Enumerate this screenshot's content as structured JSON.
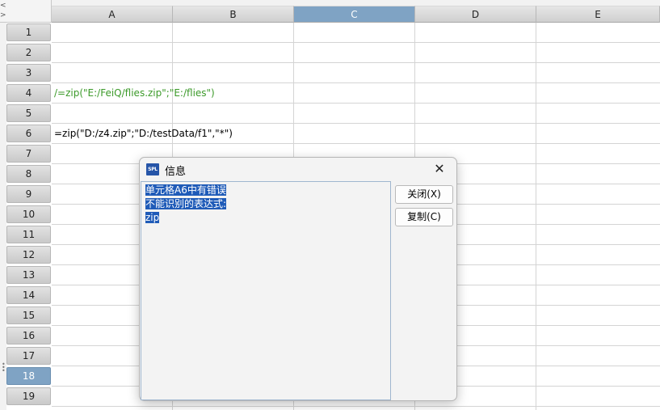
{
  "columns": [
    {
      "label": "A",
      "selected": false
    },
    {
      "label": "B",
      "selected": false
    },
    {
      "label": "C",
      "selected": true
    },
    {
      "label": "D",
      "selected": false
    },
    {
      "label": "E",
      "selected": false
    }
  ],
  "rows": [
    {
      "label": "1",
      "selected": false
    },
    {
      "label": "2",
      "selected": false
    },
    {
      "label": "3",
      "selected": false
    },
    {
      "label": "4",
      "selected": false
    },
    {
      "label": "5",
      "selected": false
    },
    {
      "label": "6",
      "selected": false
    },
    {
      "label": "7",
      "selected": false
    },
    {
      "label": "8",
      "selected": false
    },
    {
      "label": "9",
      "selected": false
    },
    {
      "label": "10",
      "selected": false
    },
    {
      "label": "11",
      "selected": false
    },
    {
      "label": "12",
      "selected": false
    },
    {
      "label": "13",
      "selected": false
    },
    {
      "label": "14",
      "selected": false
    },
    {
      "label": "15",
      "selected": false
    },
    {
      "label": "16",
      "selected": false
    },
    {
      "label": "17",
      "selected": false
    },
    {
      "label": "18",
      "selected": true
    },
    {
      "label": "19",
      "selected": false
    }
  ],
  "cells": {
    "A4": {
      "text": "/=zip(\"E:/FeiQ/flies.zip\";\"E:/flies\")",
      "color": "#3c9a2a"
    },
    "A6": {
      "text": "=zip(\"D:/z4.zip\";\"D:/testData/f1\",\"*\")",
      "color": "#000000"
    }
  },
  "dialog": {
    "icon": "SPL",
    "title": "信息",
    "message": [
      "单元格A6中有错误",
      "不能识别的表达式:",
      "zip"
    ],
    "close_button": "关闭(X)",
    "copy_button": "复制(C)"
  },
  "colors": {
    "selected_header": "#7fa3c4",
    "selection_highlight": "#1f5bb8",
    "green_text": "#3c9a2a"
  }
}
